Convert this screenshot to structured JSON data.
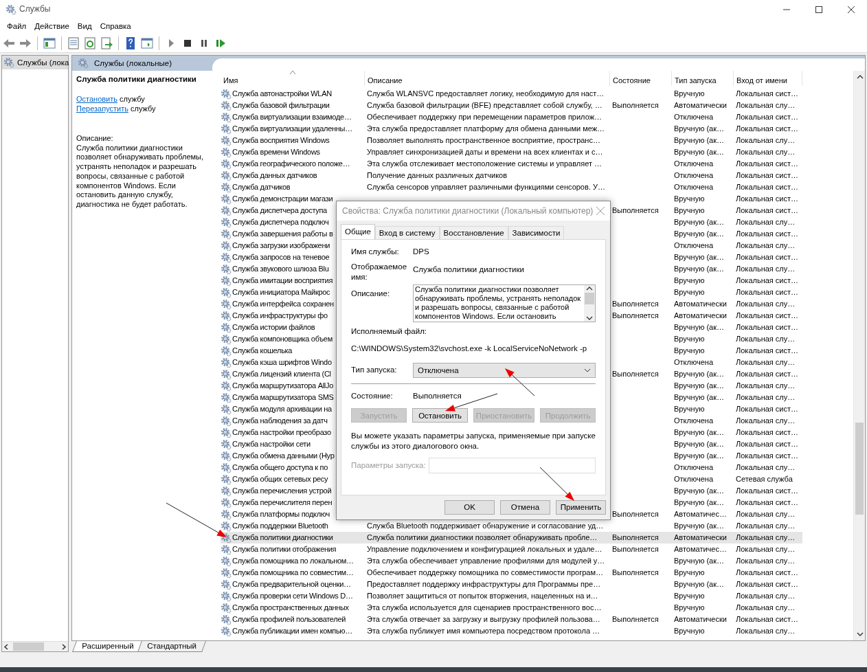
{
  "window": {
    "title": "Службы"
  },
  "menu": [
    "Файл",
    "Действие",
    "Вид",
    "Справка"
  ],
  "tree": {
    "items": [
      {
        "label": "Службы (лока",
        "selected": true
      }
    ]
  },
  "panel": {
    "title": "Службы (локальные)"
  },
  "details": {
    "title": "Служба политики диагностики",
    "actions": [
      {
        "link": "Остановить",
        "text": "службу"
      },
      {
        "link": "Перезапустить",
        "text": "службу"
      }
    ],
    "description_label": "Описание:",
    "description": "Служба политики диагностики позволяет обнаруживать проблемы, устранять неполадок и разрешать вопросы, связанные с работой компонентов Windows.  Если остановить данную службу, диагностика не будет работать."
  },
  "table": {
    "columns": [
      {
        "label": "Имя",
        "sorted": true
      },
      {
        "label": "Описание",
        "sorted": false
      },
      {
        "label": "Состояние",
        "sorted": false
      },
      {
        "label": "Тип запуска",
        "sorted": false
      },
      {
        "label": "Вход от имени",
        "sorted": false
      }
    ],
    "rows": [
      {
        "name": "Служба автонастройки WLAN",
        "description": "Служба WLANSVC предоставляет логику, необходимую для наст…",
        "startup": "Вручную",
        "logon": "Локальная сист…",
        "selected": false
      },
      {
        "name": "Служба базовой фильтрации",
        "description": "Служба базовой фильтрации (BFE) представляет собой службу, …",
        "status": "Выполняется",
        "startup": "Автоматически",
        "logon": "Локальная слу…",
        "selected": false
      },
      {
        "name": "Служба виртуализации взаимоде…",
        "description": "Обеспечивает поддержку при перемещении параметров прилож…",
        "startup": "Отключена",
        "logon": "Локальная сист…",
        "selected": false
      },
      {
        "name": "Служба виртуализации удаленны…",
        "description": "Эта служба предоставляет платформу для обмена данными меж…",
        "startup": "Вручную (ак…",
        "logon": "Локальная сист…",
        "selected": false
      },
      {
        "name": "Служба восприятия Windows",
        "description": "Позволяет выполнять пространственное восприятие, пространс…",
        "startup": "Вручную (ак…",
        "logon": "Локальная слу…",
        "selected": false
      },
      {
        "name": "Служба времени Windows",
        "description": "Управляет синхронизацией даты и времени на всех клиентах и с…",
        "startup": "Вручную (ак…",
        "logon": "Локальная слу…",
        "selected": false
      },
      {
        "name": "Служба географического положе…",
        "description": "Эта служба отслеживает местоположение системы и управляет …",
        "startup": "Отключена",
        "logon": "Локальная сист…",
        "selected": false
      },
      {
        "name": "Служба данных датчиков",
        "description": "Получение данных различных датчиков",
        "startup": "Отключена",
        "logon": "Локальная сист…",
        "selected": false
      },
      {
        "name": "Служба датчиков",
        "description": "Служба сенсоров управляет различными функциями сенсоров. У…",
        "startup": "Отключена",
        "logon": "Локальная сист…",
        "selected": false
      },
      {
        "name": "Служба демонстрации магази",
        "startup": "Вручную",
        "logon": "Локальная сист…",
        "selected": false
      },
      {
        "name": "Служба диспетчера доступа",
        "status": "Выполняется",
        "startup": "Вручную",
        "logon": "Локальная сист…",
        "selected": false
      },
      {
        "name": "Служба диспетчера подключ",
        "startup": "Вручную (ак…",
        "logon": "Локальная слу…",
        "selected": false
      },
      {
        "name": "Служба завершения работы в",
        "startup": "Вручную (ак…",
        "logon": "Локальная сист…",
        "selected": false
      },
      {
        "name": "Служба загрузки изображени",
        "startup": "Отключена",
        "logon": "Локальная слу…",
        "selected": false
      },
      {
        "name": "Служба запросов на теневое",
        "startup": "Вручную (ак…",
        "logon": "Локальная сист…",
        "selected": false
      },
      {
        "name": "Служба звукового шлюза Blu",
        "startup": "Вручную (ак…",
        "logon": "Локальная слу…",
        "selected": false
      },
      {
        "name": "Служба имитации восприятия",
        "startup": "Вручную",
        "logon": "Локальная сист…",
        "selected": false
      },
      {
        "name": "Служба инициатора Майкрос",
        "startup": "Вручную",
        "logon": "Локальная сист…",
        "selected": false
      },
      {
        "name": "Служба интерфейса сохранен",
        "status": "Выполняется",
        "startup": "Автоматически",
        "logon": "Локальная слу…",
        "selected": false
      },
      {
        "name": "Служба инфраструктуры фо",
        "status": "Выполняется",
        "startup": "Автоматически",
        "logon": "Локальная сист…",
        "selected": false
      },
      {
        "name": "Служба истории файлов",
        "startup": "Вручную (ак…",
        "logon": "Локальная сист…",
        "selected": false
      },
      {
        "name": "Служба компоновщика объем",
        "startup": "Вручную",
        "logon": "Локальная слу…",
        "selected": false
      },
      {
        "name": "Служба кошелька",
        "startup": "Вручную",
        "logon": "Локальная сист…",
        "selected": false
      },
      {
        "name": "Служба кэша шрифтов Windo",
        "startup": "Отключена",
        "logon": "Локальная слу…",
        "selected": false
      },
      {
        "name": "Служба лицензий клиента (Cl",
        "status": "Выполняется",
        "startup": "Вручную (ак…",
        "logon": "Локальная сист…",
        "selected": false
      },
      {
        "name": "Служба маршрутизатора AllJo",
        "startup": "Вручную (ак…",
        "logon": "Локальная слу…",
        "selected": false
      },
      {
        "name": "Служба маршрутизатора SMS",
        "startup": "Вручную (ак…",
        "logon": "Локальная слу…",
        "selected": false
      },
      {
        "name": "Служба модуля архивации на",
        "startup": "Вручную",
        "logon": "Локальная сист…",
        "selected": false
      },
      {
        "name": "Служба наблюдения за датч",
        "startup": "Отключена",
        "logon": "Локальная слу…",
        "selected": false
      },
      {
        "name": "Служба настройки преобразо",
        "startup": "Вручную (ак…",
        "logon": "Локальная сист…",
        "selected": false
      },
      {
        "name": "Служба настройки сети",
        "startup": "Вручную (ак…",
        "logon": "Локальная сист…",
        "selected": false
      },
      {
        "name": "Служба обмена данными (Hyp",
        "startup": "Вручную (ак…",
        "logon": "Локальная сист…",
        "selected": false
      },
      {
        "name": "Служба общего доступа к по",
        "startup": "Отключена",
        "logon": "Локальная слу…",
        "selected": false
      },
      {
        "name": "Служба общих сетевых ресу",
        "startup": "Отключена",
        "logon": "Сетевая служба",
        "selected": false
      },
      {
        "name": "Служба перечисления устрой",
        "startup": "Вручную (ак…",
        "logon": "Локальная сист…",
        "selected": false
      },
      {
        "name": "Служба перечислителя перен",
        "startup": "Вручную (ак…",
        "logon": "Локальная сист…",
        "selected": false
      },
      {
        "name": "Служба платформы подключ",
        "status": "Выполняется",
        "startup": "Автоматичес…",
        "logon": "Локальная слу…",
        "selected": false
      },
      {
        "name": "Служба поддержки Bluetooth",
        "description": "Служба Bluetooth поддерживает обнаружение и согласование уд…",
        "startup": "Вручную (ак…",
        "logon": "Локальная слу…",
        "selected": false
      },
      {
        "name": "Служба политики диагностики",
        "description": "Служба политики диагностики позволяет обнаруживать пробле…",
        "status": "Выполняется",
        "startup": "Автоматически",
        "logon": "Локальная слу…",
        "selected": true
      },
      {
        "name": "Служба политики отображения",
        "description": "Управление подключением и конфигурацией локальных и удале…",
        "status": "Выполняется",
        "startup": "Автоматичес…",
        "logon": "Локальная слу…",
        "selected": false
      },
      {
        "name": "Служба помощника по локальном…",
        "description": "Эта служба обеспечивает управление профилями для модулей у…",
        "startup": "Вручную (ак…",
        "logon": "Локальная слу…",
        "selected": false
      },
      {
        "name": "Служба помощника по совместим…",
        "description": "Обеспечивает поддержку помощника по совместимости програм…",
        "status": "Выполняется",
        "startup": "Вручную",
        "logon": "Локальная сист…",
        "selected": false
      },
      {
        "name": "Служба предварительной оценки…",
        "description": "Предоставляет поддержку инфраструктуры для Программы пре…",
        "startup": "Вручную (ак…",
        "logon": "Локальная сист…",
        "selected": false
      },
      {
        "name": "Служба проверки сети Windows D…",
        "description": "Позволяет защититься от попыток вторжения, нацеленных на и…",
        "startup": "Вручную",
        "logon": "Локальная слу…",
        "selected": false
      },
      {
        "name": "Служба пространственных данных",
        "description": "Эта служба используется для сценариев пространственного вос…",
        "startup": "Вручную",
        "logon": "Локальная слу…",
        "selected": false
      },
      {
        "name": "Служба профилей пользователей",
        "description": "Эта служба отвечает за загрузку и выгрузку профилей пользова…",
        "status": "Выполняется",
        "startup": "Автоматически",
        "logon": "Локальная сист…",
        "selected": false
      },
      {
        "name": "Служба публикации имен компью…",
        "description": "Эта служба публикует имя компьютера посредством протокола …",
        "startup": "Вручную",
        "logon": "Локальная слу…",
        "selected": false
      }
    ]
  },
  "view_tabs": [
    {
      "label": "Расширенный",
      "selected": true
    },
    {
      "label": "Стандартный",
      "selected": false
    }
  ],
  "dialog": {
    "title": "Свойства: Служба политики диагностики (Локальный компьютер)",
    "tabs": [
      {
        "label": "Общие",
        "selected": true
      },
      {
        "label": "Вход в систему",
        "selected": false
      },
      {
        "label": "Восстановление",
        "selected": false
      },
      {
        "label": "Зависимости",
        "selected": false
      }
    ],
    "service_name_label": "Имя службы:",
    "service_name": "DPS",
    "display_name_label": "Отображаемое имя:",
    "display_name": "Служба политики диагностики",
    "description_label": "Описание:",
    "description": "Служба политики диагностики позволяет обнаруживать проблемы, устранять неполадок и разрешать вопросы, связанные с работой компонентов Windows.  Если остановить",
    "executable_label": "Исполняемый файл:",
    "executable_path": "C:\\WINDOWS\\System32\\svchost.exe -k LocalServiceNoNetwork -p",
    "startup_type_label": "Тип запуска:",
    "startup_type": "Отключена",
    "status_label": "Состояние:",
    "status": "Выполняется",
    "service_buttons": [
      {
        "label": "Запустить",
        "disabled": true
      },
      {
        "label": "Остановить",
        "disabled": false
      },
      {
        "label": "Приостановить",
        "disabled": true
      },
      {
        "label": "Продолжить",
        "disabled": true
      }
    ],
    "hint": "Вы можете указать параметры запуска, применяемые при запуске службы из этого диалогового окна.",
    "params_label": "Параметры запуска:",
    "params_disabled": true,
    "buttons": [
      "OK",
      "Отмена",
      "Применить"
    ]
  }
}
